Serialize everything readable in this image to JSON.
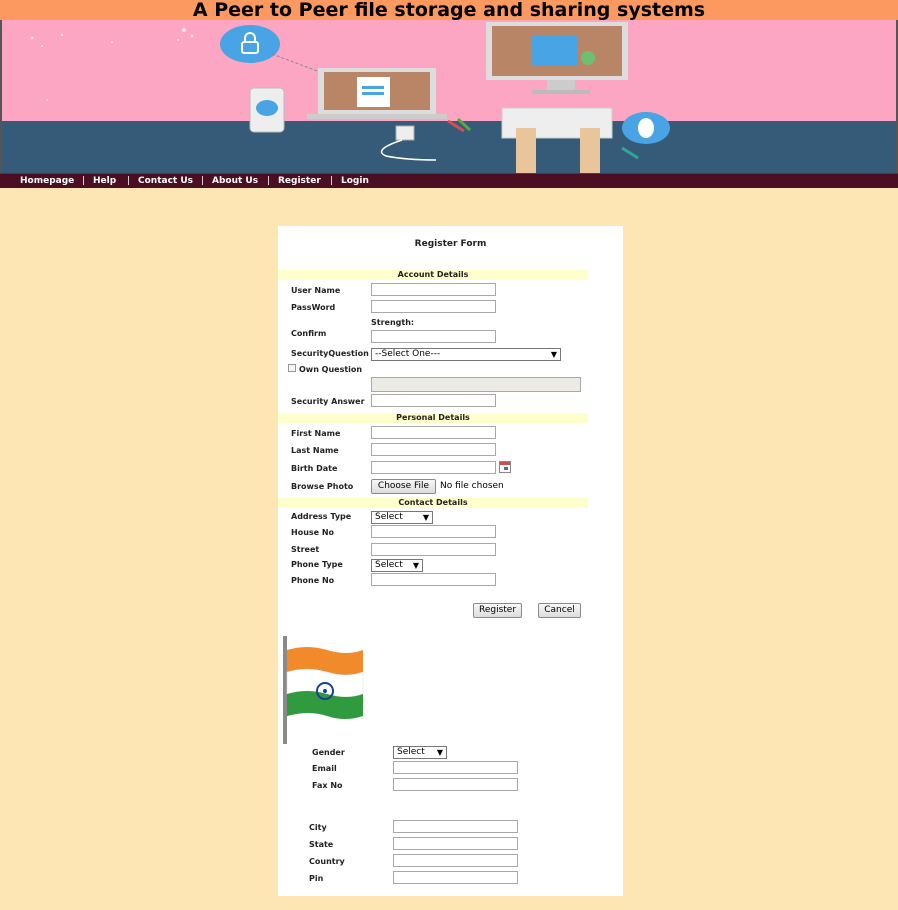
{
  "header": {
    "title": "A Peer to Peer file storage and sharing systems"
  },
  "nav": {
    "items": [
      "Homepage",
      "Help",
      "Contact Us",
      "About Us",
      "Register",
      "Login"
    ],
    "separator": "|"
  },
  "form": {
    "title": "Register Form",
    "sections": {
      "account": "Account Details",
      "personal": "Personal Details",
      "contact": "Contact Details"
    },
    "labels": {
      "username": "User Name",
      "password": "PassWord",
      "strength": "Strength:",
      "confirm": "Confirm",
      "security_question": "SecurityQuestion",
      "own_question": "Own Question",
      "security_answer": "Security Answer",
      "first_name": "First Name",
      "last_name": "Last Name",
      "birth_date": "Birth Date",
      "browse_photo": "Browse Photo",
      "address_type": "Address Type",
      "house_no": "House No",
      "street": "Street",
      "phone_type": "Phone Type",
      "phone_no": "Phone No",
      "gender": "Gender",
      "email": "Email",
      "fax_no": "Fax No",
      "city": "City",
      "state": "State",
      "country": "Country",
      "pin": "Pin"
    },
    "selects": {
      "security_question": "--Select One---",
      "address_type": "Select",
      "phone_type": "Select",
      "gender": "Select"
    },
    "file": {
      "button": "Choose File",
      "status": "No file chosen"
    },
    "buttons": {
      "register": "Register",
      "cancel": "Cancel"
    }
  },
  "colors": {
    "page_bg": "#fee6b4",
    "title_bar": "#fc9960",
    "nav_bg": "#4a0f22",
    "section_bg": "#ffffcc"
  }
}
